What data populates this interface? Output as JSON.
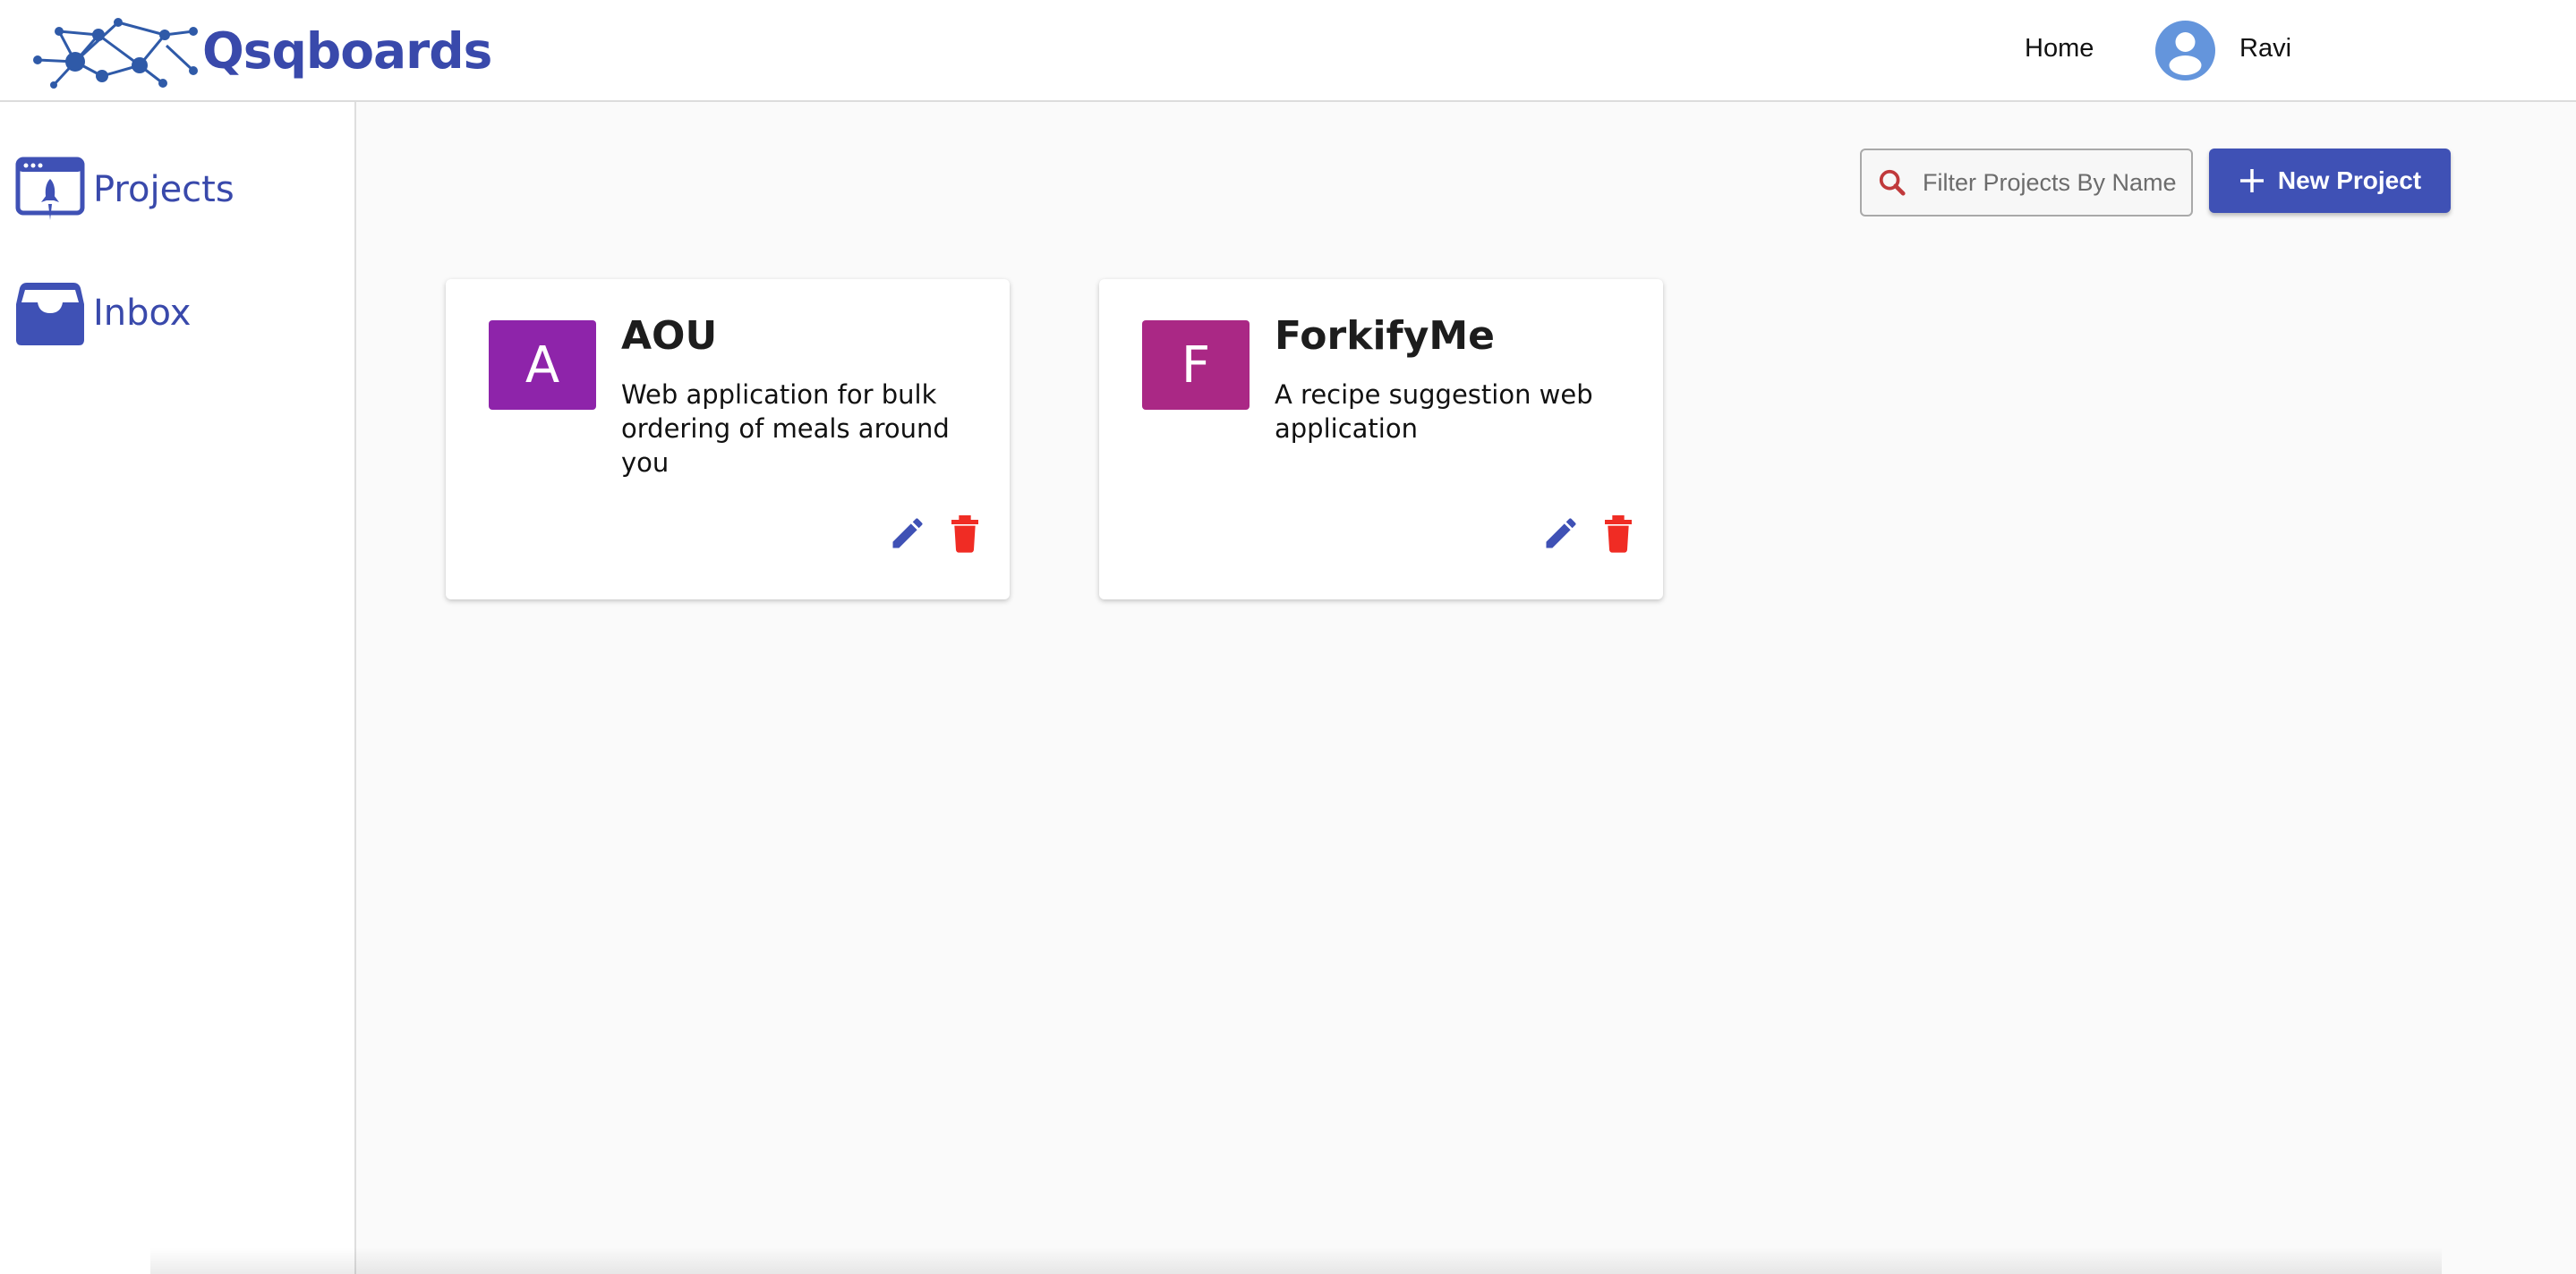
{
  "brand": {
    "name": "Qsqboards",
    "logo_icon": "network-graph-icon",
    "color": "#3949ab"
  },
  "header": {
    "nav_home": "Home",
    "user_name": "Ravi",
    "avatar_icon": "user-avatar-icon"
  },
  "sidebar": {
    "items": [
      {
        "label": "Projects",
        "icon": "rocket-window-icon"
      },
      {
        "label": "Inbox",
        "icon": "inbox-tray-icon"
      }
    ]
  },
  "toolbar": {
    "search_placeholder": "Filter Projects By Name",
    "new_project_label": "New Project",
    "accent": "#3f51b5"
  },
  "projects": [
    {
      "initial": "A",
      "name": "AOU",
      "description": "Web application for bulk ordering of meals around you",
      "color": "#8e24aa"
    },
    {
      "initial": "F",
      "name": "ForkifyMe",
      "description": "A recipe suggestion web application",
      "color": "#aa2885"
    }
  ],
  "colors": {
    "edit_icon": "#3f51b5",
    "delete_icon": "#f02c24"
  }
}
